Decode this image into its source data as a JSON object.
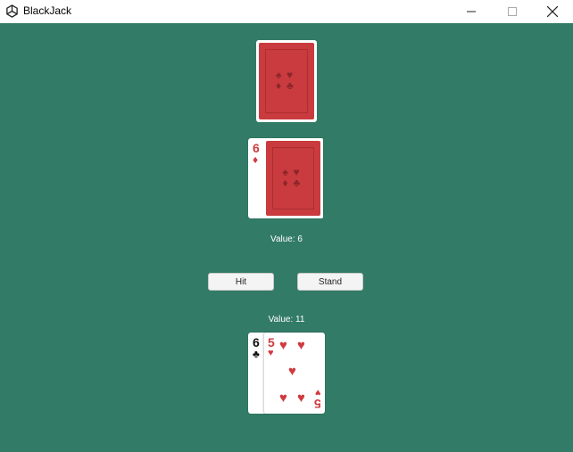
{
  "window": {
    "title": "BlackJack",
    "minimize_icon": "minimize-icon",
    "maximize_icon": "maximize-icon",
    "close_icon": "close-icon"
  },
  "colors": {
    "table": "#327b67",
    "card_back": "#c93b3e",
    "red_suit": "#d03a3e"
  },
  "dealer": {
    "cards": [
      {
        "face": "down"
      },
      {
        "face": "up",
        "rank": "6",
        "suit": "♦"
      },
      {
        "face": "down"
      }
    ],
    "value_label": "Value: 6"
  },
  "buttons": {
    "hit": "Hit",
    "stand": "Stand"
  },
  "player": {
    "value_label": "Value: 11",
    "cards": [
      {
        "rank": "6",
        "suit": "♣"
      },
      {
        "rank": "5",
        "suit": "♥"
      }
    ]
  },
  "back_suits": [
    "♠",
    "♥",
    "♦",
    "♣"
  ]
}
